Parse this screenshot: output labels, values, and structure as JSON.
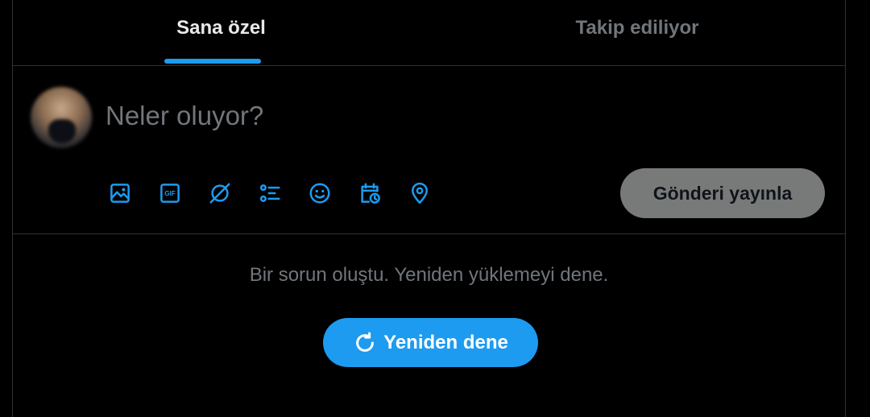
{
  "tabs": [
    {
      "label": "Sana özel",
      "active": true
    },
    {
      "label": "Takip ediliyor",
      "active": false
    }
  ],
  "composer": {
    "placeholder": "Neler oluyor?",
    "tools": [
      "image-icon",
      "gif-icon",
      "grok-icon",
      "poll-icon",
      "emoji-icon",
      "schedule-icon",
      "location-icon"
    ],
    "post_label": "Gönderi yayınla"
  },
  "error": {
    "message": "Bir sorun oluştu. Yeniden yüklemeyi dene.",
    "retry_label": "Yeniden dene"
  },
  "colors": {
    "accent": "#1d9bf0",
    "background": "#000000",
    "border": "#2f3336",
    "muted_text": "#71767b",
    "post_button_disabled": "#787a7a"
  }
}
